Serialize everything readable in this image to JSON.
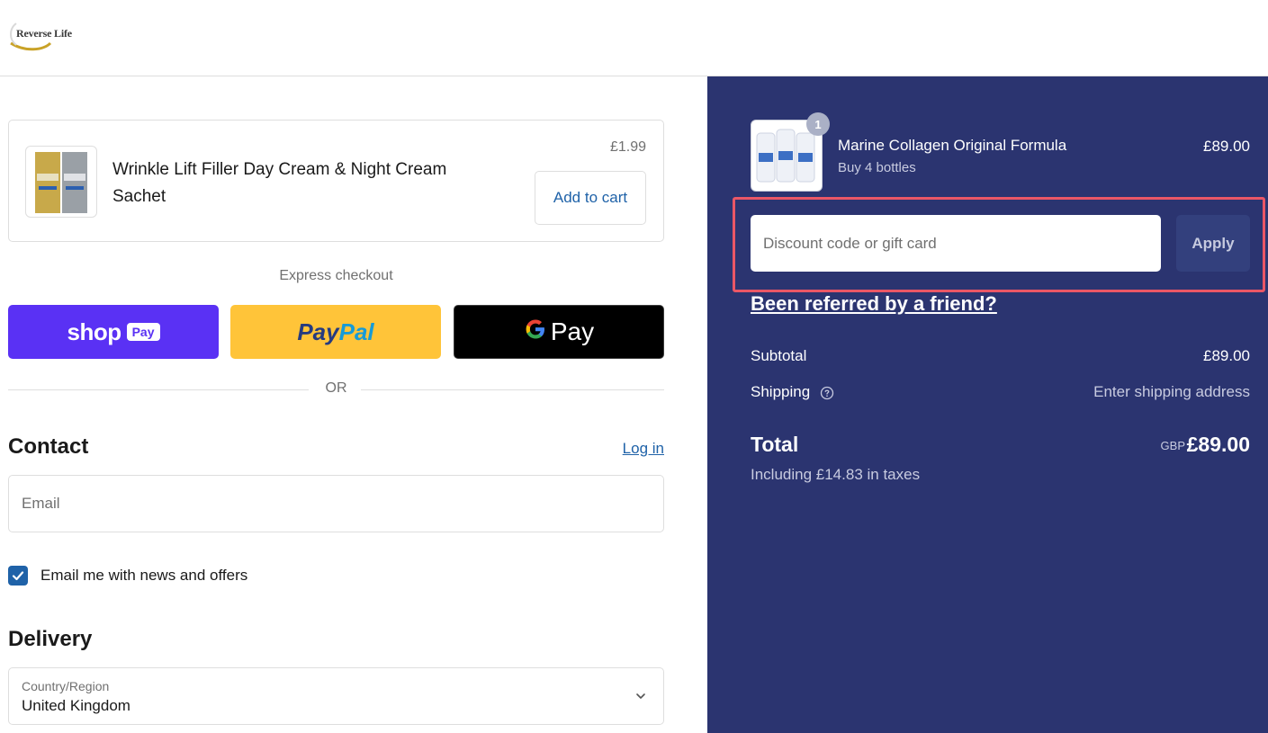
{
  "header": {
    "logo_text": "Reverse Life"
  },
  "upsell": {
    "title": "Wrinkle Lift Filler Day Cream & Night Cream Sachet",
    "price": "£1.99",
    "add_label": "Add to cart"
  },
  "express": {
    "label": "Express checkout",
    "shop_word": "shop",
    "shop_pay": "Pay",
    "paypal_a": "Pay",
    "paypal_b": "Pal",
    "gpay_word": "Pay",
    "or_label": "OR"
  },
  "contact": {
    "title": "Contact",
    "login_label": "Log in",
    "email_placeholder": "Email",
    "newsletter_label": "Email me with news and offers",
    "newsletter_checked": true
  },
  "delivery": {
    "title": "Delivery",
    "country_label": "Country/Region",
    "country_value": "United Kingdom"
  },
  "order": {
    "quantity": "1",
    "product_name": "Marine Collagen Original Formula",
    "product_variant": "Buy 4 bottles",
    "product_price": "£89.00",
    "discount_placeholder": "Discount code or gift card",
    "apply_label": "Apply",
    "referral_label": "Been referred by a friend?",
    "subtotal_label": "Subtotal",
    "subtotal_value": "£89.00",
    "shipping_label": "Shipping",
    "shipping_value": "Enter shipping address",
    "total_label": "Total",
    "currency": "GBP",
    "total_value": "£89.00",
    "tax_note": "Including £14.83 in taxes"
  },
  "colors": {
    "summary_bg": "#2b3470",
    "link": "#1f62a8",
    "shop_pay": "#5a31f4",
    "paypal": "#ffc439",
    "highlight": "#ea5766"
  }
}
